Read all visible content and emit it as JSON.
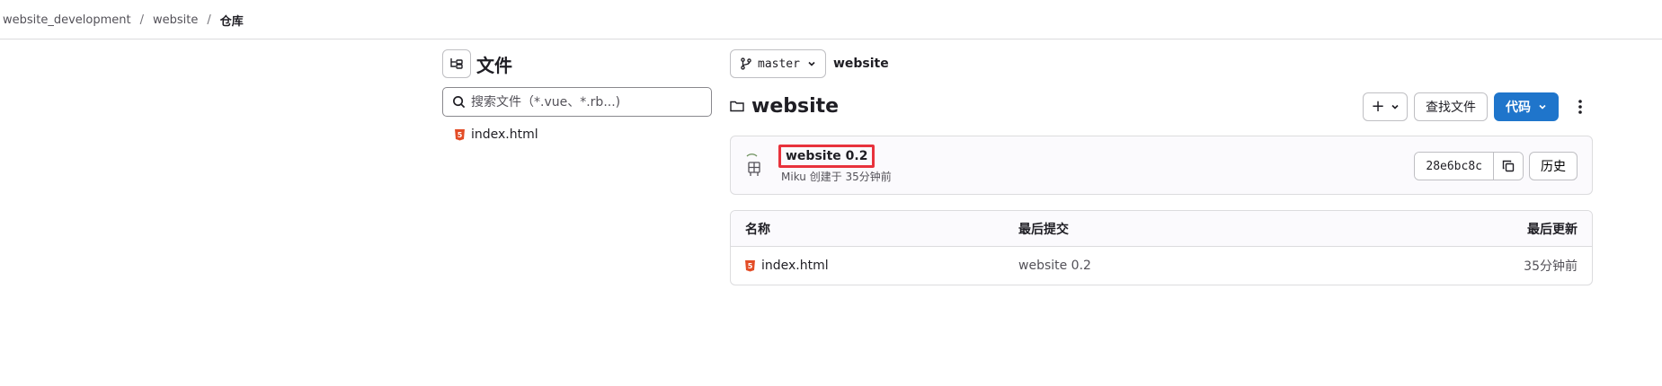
{
  "breadcrumb": {
    "items": [
      "website_development",
      "website",
      "仓库"
    ],
    "separator": "/"
  },
  "file_tree": {
    "title": "文件",
    "search_placeholder": "搜索文件（*.vue、*.rb...)",
    "files": [
      {
        "name": "index.html",
        "icon": "html5-icon"
      }
    ]
  },
  "branch": {
    "name": "master",
    "path": "website"
  },
  "repo": {
    "title": "website"
  },
  "actions": {
    "plus_label": "+",
    "find_file_label": "查找文件",
    "code_label": "代码"
  },
  "commit": {
    "title": "website 0.2",
    "author": "Miku",
    "meta": "创建于 35分钟前",
    "sha": "28e6bc8c",
    "history_label": "历史"
  },
  "table": {
    "headers": {
      "name": "名称",
      "last_commit": "最后提交",
      "last_update": "最后更新"
    },
    "rows": [
      {
        "name": "index.html",
        "last_commit": "website 0.2",
        "last_update": "35分钟前"
      }
    ]
  },
  "colors": {
    "primary": "#1f75cb",
    "highlight_box": "#e8323c",
    "html_icon": "#e34c26"
  }
}
